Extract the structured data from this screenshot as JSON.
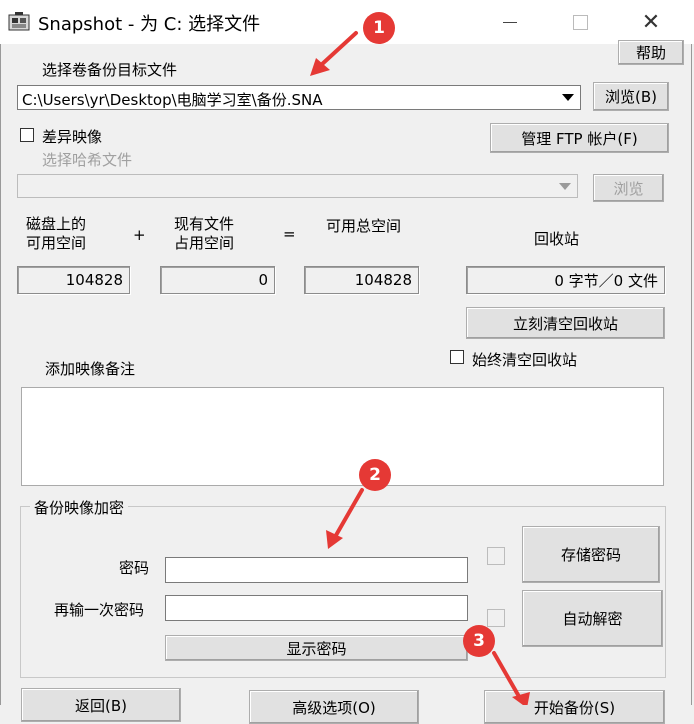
{
  "window": {
    "title": "Snapshot - 为 C: 选择文件",
    "help_label": "帮助"
  },
  "target": {
    "label": "选择卷备份目标文件",
    "path_value": "C:\\Users\\yr\\Desktop\\电脑学习室\\备份.SNA",
    "browse_label": "浏览(B)"
  },
  "diff": {
    "checkbox_label": "差异映像",
    "ftp_label": "管理 FTP 帐户(F)",
    "hash_label": "选择哈希文件",
    "hash_value": "",
    "browse_label": "浏览"
  },
  "space": {
    "disk_free_label": "磁盘上的\n可用空间",
    "plus": "+",
    "existing_label": "现有文件\n占用空间",
    "equals": "=",
    "total_label": "可用总空间",
    "recycle_label": "回收站",
    "disk_free_value": "104828",
    "existing_value": "0",
    "total_value": "104828",
    "recycle_value": "0 字节／0 文件",
    "empty_now_label": "立刻清空回收站",
    "always_empty_label": "始终清空回收站"
  },
  "comment": {
    "label": "添加映像备注",
    "value": ""
  },
  "encryption": {
    "group_label": "备份映像加密",
    "password_label": "密码",
    "password_value": "",
    "repeat_label": "再输一次密码",
    "repeat_value": "",
    "show_label": "显示密码",
    "store_label": "存储密码",
    "auto_decrypt_label": "自动解密"
  },
  "footer": {
    "back_label": "返回(B)",
    "advanced_label": "高级选项(O)",
    "start_label": "开始备份(S)"
  },
  "annotations": {
    "badge1": "1",
    "badge2": "2",
    "badge3": "3",
    "color": "#e53935"
  }
}
